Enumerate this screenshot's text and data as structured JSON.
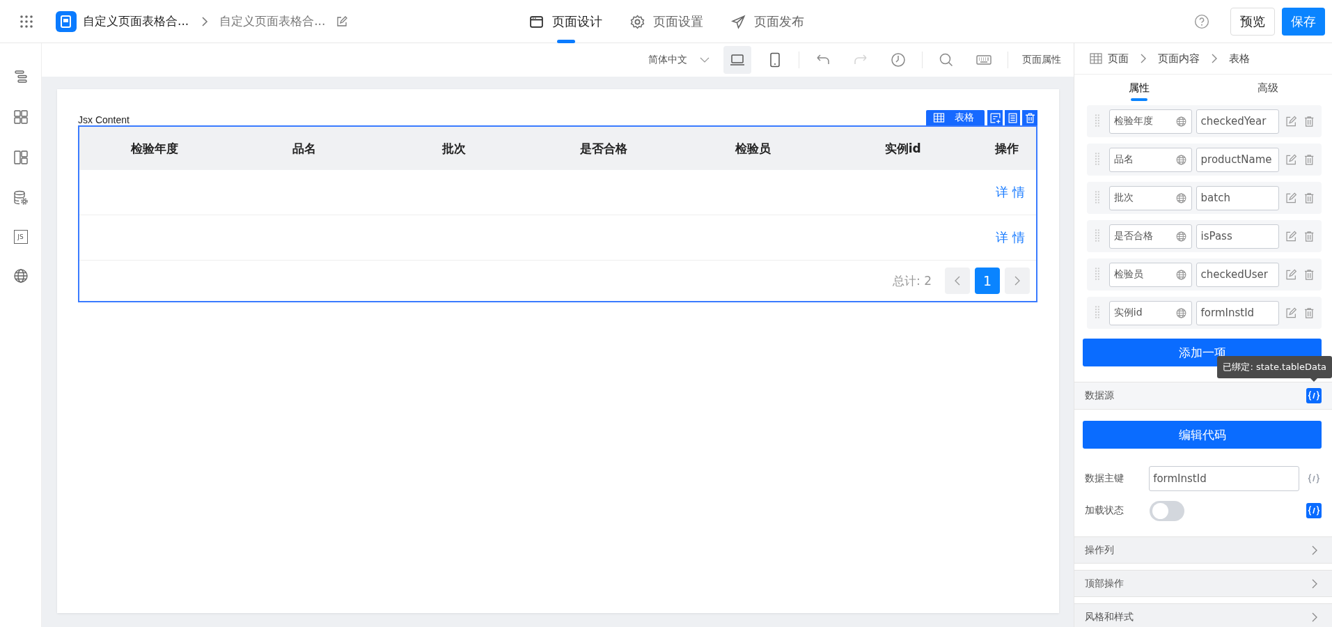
{
  "app_bar": {
    "breadcrumb": [
      "自定义页面表格合...",
      "自定义页面表格合..."
    ],
    "nav_tabs": [
      {
        "label": "页面设计",
        "kind": "design",
        "selected": true
      },
      {
        "label": "页面设置",
        "kind": "settings",
        "selected": false
      },
      {
        "label": "页面发布",
        "kind": "publish",
        "selected": false
      }
    ],
    "buttons": [
      {
        "label": "预览",
        "kind": "default"
      },
      {
        "label": "保存",
        "kind": "primary"
      }
    ]
  },
  "sidebar": {
    "items": [
      {
        "kind": "outline"
      },
      {
        "kind": "components"
      },
      {
        "kind": "layout"
      },
      {
        "kind": "datasource"
      },
      {
        "kind": "js",
        "text": "JS"
      },
      {
        "kind": "globe"
      }
    ]
  },
  "toolbar": {
    "language": "简体中文",
    "devices": [
      {
        "kind": "desktop",
        "selected": true
      },
      {
        "kind": "mobile",
        "selected": false
      }
    ],
    "actions": [
      {
        "kind": "undo",
        "disabled": false
      },
      {
        "kind": "redo",
        "disabled": true
      },
      {
        "kind": "history",
        "disabled": false
      }
    ],
    "page_properties": "页面属性"
  },
  "canvas": {
    "block_label": "Jsx Content",
    "component_tag": "表格",
    "table": {
      "columns": [
        "检验年度",
        "品名",
        "批次",
        "是否合格",
        "检验员",
        "实例id",
        "操作"
      ],
      "rows": [
        {
          "action": "详 情"
        },
        {
          "action": "详 情"
        }
      ]
    },
    "pagination": {
      "total": "总计: 2",
      "pages": [
        {
          "label": "1",
          "selected": true
        }
      ]
    }
  },
  "panel": {
    "breadcrumb": [
      "页面",
      "页面内容",
      "表格"
    ],
    "tabs": [
      {
        "label": "属性",
        "selected": true
      },
      {
        "label": "高级",
        "selected": false
      }
    ],
    "columns": [
      {
        "title": "检验年度",
        "field": "checkedYear"
      },
      {
        "title": "品名",
        "field": "productName"
      },
      {
        "title": "批次",
        "field": "batch"
      },
      {
        "title": "是否合格",
        "field": "isPass"
      },
      {
        "title": "检验员",
        "field": "checkedUser"
      },
      {
        "title": "实例id",
        "field": "formInstId"
      }
    ],
    "add_button": "添加一项",
    "tooltip": "已绑定: state.tableData",
    "data_source": {
      "label": "数据源",
      "bound": true
    },
    "edit_code": "编辑代码",
    "primary_key": {
      "label": "数据主键",
      "value": "formInstId",
      "bound": false
    },
    "loading": {
      "label": "加载状态",
      "on": false,
      "bound": true
    },
    "sections": [
      {
        "label": "操作列",
        "expanded": false
      },
      {
        "label": "顶部操作",
        "expanded": false
      },
      {
        "label": "风格和样式",
        "expanded": false
      }
    ]
  }
}
